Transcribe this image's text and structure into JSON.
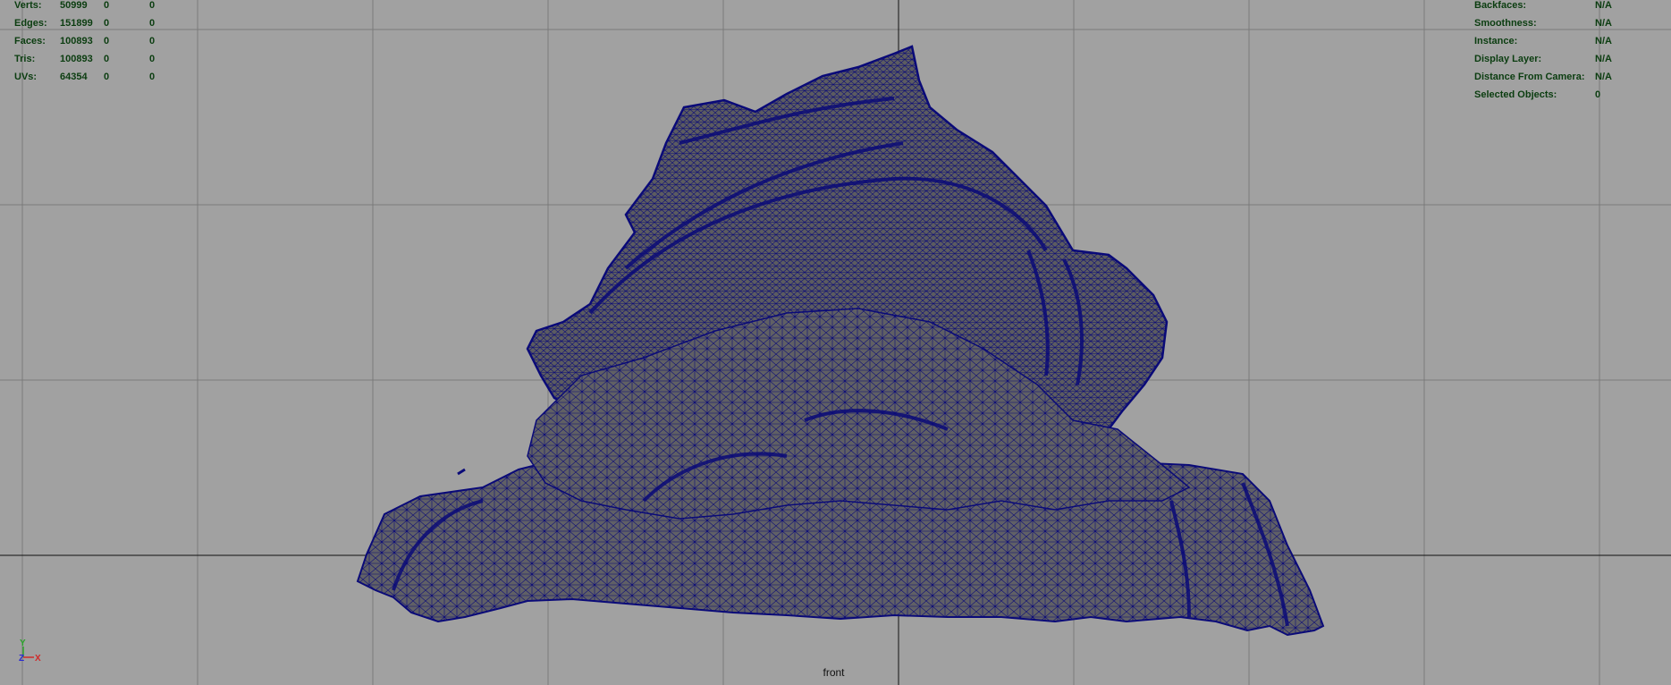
{
  "viewport": {
    "camera_name": "front",
    "background_color": "#a1a1a1",
    "grid_color": "#777777",
    "axis_line_color": "#111111",
    "wireframe_color": "#0a0a78",
    "mesh_fill_color": "#5e5e62"
  },
  "hud_left": {
    "rows": [
      {
        "label": "Verts:",
        "total": "50999",
        "selected": "0",
        "highlighted": "0"
      },
      {
        "label": "Edges:",
        "total": "151899",
        "selected": "0",
        "highlighted": "0"
      },
      {
        "label": "Faces:",
        "total": "100893",
        "selected": "0",
        "highlighted": "0"
      },
      {
        "label": "Tris:",
        "total": "100893",
        "selected": "0",
        "highlighted": "0"
      },
      {
        "label": "UVs:",
        "total": "64354",
        "selected": "0",
        "highlighted": "0"
      }
    ]
  },
  "hud_right": {
    "rows": [
      {
        "label": "Backfaces:",
        "value": "N/A"
      },
      {
        "label": "Smoothness:",
        "value": "N/A"
      },
      {
        "label": "Instance:",
        "value": "N/A"
      },
      {
        "label": "Display Layer:",
        "value": "N/A"
      },
      {
        "label": "Distance From Camera:",
        "value": "N/A"
      },
      {
        "label": "Selected Objects:",
        "value": "0"
      }
    ]
  },
  "axis_gizmo": {
    "y_label": "Y",
    "z_label": "Z",
    "x_label": "X",
    "y_color": "#2aa52a",
    "z_color": "#2a2ad0",
    "x_color": "#d02a2a"
  }
}
